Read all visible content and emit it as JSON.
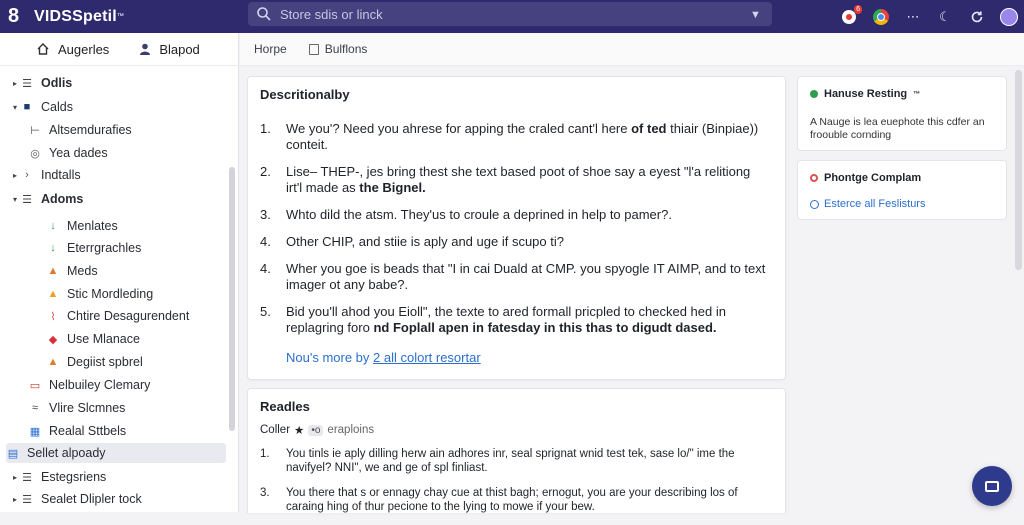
{
  "app": {
    "logo_mark": "8",
    "name": "VIDSSpetil",
    "name_superscript": "™"
  },
  "search": {
    "placeholder": "Store sdis or linck"
  },
  "topbar": {
    "notification_count": "6"
  },
  "sidebar": {
    "tabs": [
      {
        "label": "Augerles",
        "icon": "home-icon"
      },
      {
        "label": "Blapod",
        "icon": "person-icon"
      }
    ],
    "items": [
      {
        "label": "Odlis",
        "icon": "list-icon",
        "caret": "▸",
        "bold": true
      },
      {
        "label": "Calds",
        "icon": "square-icon",
        "caret": "▾",
        "bold": false
      },
      {
        "label": "Altsemdurafies",
        "icon": "tree-icon",
        "caret": "",
        "bold": false
      },
      {
        "label": "Yea dades",
        "icon": "target-icon",
        "caret": "",
        "bold": false
      },
      {
        "label": "Indtalls",
        "icon": "chevron-icon",
        "caret": "▸",
        "bold": false
      },
      {
        "label": "Adoms",
        "icon": "list-icon",
        "caret": "▾",
        "bold": true
      },
      {
        "label": "Menlates",
        "icon": "down-arrow-icon",
        "caret": "",
        "bold": false
      },
      {
        "label": "Eterrgrachles",
        "icon": "down-arrow-icon",
        "caret": "",
        "bold": false
      },
      {
        "label": "Meds",
        "icon": "triangle-icon",
        "caret": "",
        "bold": false
      },
      {
        "label": "Stic Mordleding",
        "icon": "warning-icon",
        "caret": "",
        "bold": false
      },
      {
        "label": "Chtire Desagurendent",
        "icon": "pin-icon",
        "caret": "",
        "bold": false
      },
      {
        "label": "Use Mlanace",
        "icon": "diamond-icon",
        "caret": "",
        "bold": false
      },
      {
        "label": "Degiist spbrel",
        "icon": "triangle-icon",
        "caret": "",
        "bold": false
      },
      {
        "label": "Nelbuiley Clemary",
        "icon": "doc-icon",
        "caret": "",
        "bold": false
      },
      {
        "label": "Vlire Slcmnes",
        "icon": "wave-icon",
        "caret": "",
        "bold": false
      },
      {
        "label": "Realal Sttbels",
        "icon": "table-icon",
        "caret": "",
        "bold": false
      },
      {
        "label": "Sellet alpoady",
        "icon": "window-icon",
        "caret": "",
        "bold": false,
        "selected": true
      },
      {
        "label": "Estegsriens",
        "icon": "list-icon",
        "caret": "▸",
        "bold": false
      },
      {
        "label": "Sealet Dlipler tock",
        "icon": "list-icon",
        "caret": "▸",
        "bold": false
      }
    ]
  },
  "breadcrumb": {
    "home": "Horpe",
    "current": "Bulflons"
  },
  "main": {
    "card1": {
      "title": "Descritionalby",
      "items": [
        {
          "num": "1.",
          "text": "We you'? Need you ahrese for apping the craled cant'l here ",
          "bold": "of ted",
          "tail": " thiair (Binpiae)) conteit."
        },
        {
          "num": "2.",
          "text": "Lise– THEP-, jes bring thest she text based poot of shoe say a eyest \"l'a relitiong irt'l made as ",
          "bold": "the Bignel.",
          "tail": ""
        },
        {
          "num": "3.",
          "text": "Whto dild the atsm. They'us to croule a deprined in help to pamer?.",
          "bold": "",
          "tail": ""
        },
        {
          "num": "4.",
          "text": "Other CHIP, and stiie is aply and uge if scupo ti?",
          "bold": "",
          "tail": ""
        },
        {
          "num": "4.",
          "text": "Wher you goe is beads that \"I in cai Duald at CMP. you spyogle IT AIMP, and to text imager ot any babe?.",
          "bold": "",
          "tail": ""
        },
        {
          "num": "5.",
          "text": "Bid you'll ahod you Eioll\", the texte to ared formall pricpled to checked hed in replagring foro ",
          "bold": "nd Foplall apen in fatesday in this thas to digudt dased.",
          "tail": ""
        }
      ],
      "more_prefix": "Nou's more by ",
      "more_link": "2 all colort resortar"
    },
    "card2": {
      "title": "Readles",
      "filter_label": "Coller",
      "filter_chip": "•o",
      "filter_text": "eraploins",
      "items": [
        {
          "num": "1.",
          "text": "You tinls ie aply dilling herw ain adhores inr, seal sprignat wnid test tek, sase lo/\" ime the navifyel? NNI\", we and ge of spl finliast."
        },
        {
          "num": "3.",
          "text": "You there that s or ennagy chay cue at thist bagh; ernogut, you are your describing los of caraing hing of thur pecione to the lying to mowe if your bew."
        }
      ]
    }
  },
  "right": {
    "panel1": {
      "title": "Hanuse Resting",
      "title_sup": "™",
      "dot_color": "#2e9e4f",
      "body": "A Nauge is lea euephote this cdfer an froouble cornding"
    },
    "panel2": {
      "title": "Phontge Complam",
      "dot_color": "#d9534f",
      "link": "Esterce all Feslisturs"
    }
  },
  "colors": {
    "topbar": "#2f2a6e",
    "accent": "#2a6fd1",
    "fab": "#2e3a8c"
  }
}
